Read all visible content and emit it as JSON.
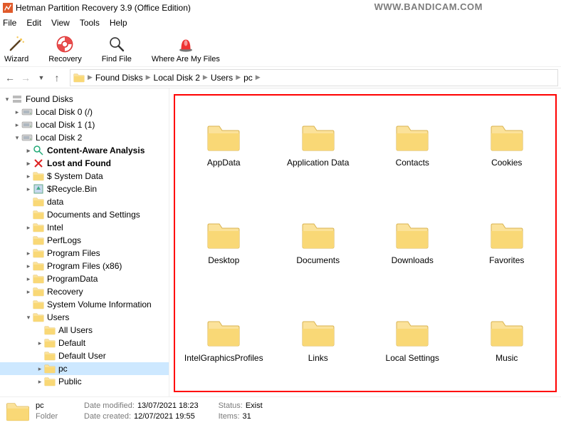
{
  "window": {
    "title": "Hetman Partition Recovery 3.9 (Office Edition)"
  },
  "watermark": "WWW.BANDICAM.COM",
  "menu": [
    "File",
    "Edit",
    "View",
    "Tools",
    "Help"
  ],
  "toolbar": {
    "wizard": "Wizard",
    "recovery": "Recovery",
    "findfile": "Find File",
    "where": "Where Are My Files"
  },
  "breadcrumbs": [
    "Found Disks",
    "Local Disk 2",
    "Users",
    "pc"
  ],
  "tree": {
    "root": "Found Disks",
    "ld0": "Local Disk 0 (/)",
    "ld1": "Local Disk 1 (1)",
    "ld2": "Local Disk 2",
    "content_aware": "Content-Aware Analysis",
    "lost_found": "Lost and Found",
    "system_data": "$ System Data",
    "recycle": "$Recycle.Bin",
    "data": "data",
    "docset": "Documents and Settings",
    "intel": "Intel",
    "perflogs": "PerfLogs",
    "progfiles": "Program Files",
    "progfiles86": "Program Files (x86)",
    "programdata": "ProgramData",
    "recovery": "Recovery",
    "svi": "System Volume Information",
    "users": "Users",
    "allusers": "All Users",
    "default": "Default",
    "defaultuser": "Default User",
    "pc": "pc",
    "public": "Public"
  },
  "folders": [
    "AppData",
    "Application Data",
    "Contacts",
    "Cookies",
    "Desktop",
    "Documents",
    "Downloads",
    "Favorites",
    "IntelGraphicsProfiles",
    "Links",
    "Local Settings",
    "Music"
  ],
  "status": {
    "name": "pc",
    "type": "Folder",
    "modified_label": "Date modified:",
    "modified": "13/07/2021 18:23",
    "created_label": "Date created:",
    "created": "12/07/2021 19:55",
    "status_label": "Status:",
    "status": "Exist",
    "items_label": "Items:",
    "items": "31"
  }
}
